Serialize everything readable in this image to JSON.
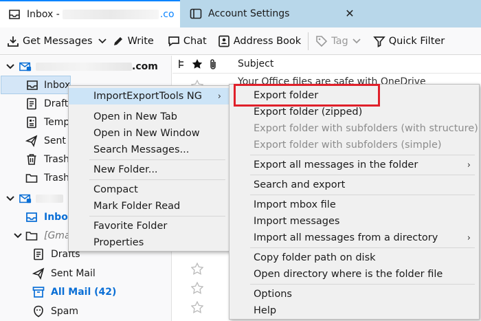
{
  "tabs": [
    {
      "label": "Inbox - ",
      "suffix": ".co"
    },
    {
      "label": "Account Settings"
    }
  ],
  "toolbar": {
    "get_messages": "Get Messages",
    "write": "Write",
    "chat": "Chat",
    "address_book": "Address Book",
    "tag": "Tag",
    "quick_filter": "Quick Filter"
  },
  "folders": {
    "account1_suffix": ".com",
    "inbox": "Inbox",
    "drafts": "Drafts",
    "templates": "Temp",
    "sent": "Sent",
    "trash1": "Trash",
    "trash2": "Trash",
    "account2_inbox": "Inbox",
    "gmail_group": "[Gma",
    "gmail_drafts": "Drafts",
    "gmail_sent": "Sent Mail",
    "gmail_allmail": "All Mail (42)",
    "gmail_spam": "Spam"
  },
  "thread": {
    "subject_header": "Subject",
    "first_subject": "Your Office files are safe with OneDrive"
  },
  "context_menu": {
    "import_export": "ImportExportTools NG",
    "open_new_tab": "Open in New Tab",
    "open_new_window": "Open in New Window",
    "search_messages": "Search Messages...",
    "new_folder": "New Folder...",
    "compact": "Compact",
    "mark_read": "Mark Folder Read",
    "favorite": "Favorite Folder",
    "properties": "Properties"
  },
  "submenu": {
    "export_folder": "Export folder",
    "export_zipped": "Export folder (zipped)",
    "export_sub_structure": "Export folder with subfolders (with structure)",
    "export_sub_simple": "Export folder with subfolders (simple)",
    "export_all": "Export all messages in the folder",
    "search_export": "Search and export",
    "import_mbox": "Import mbox file",
    "import_messages": "Import messages",
    "import_all_dir": "Import all messages from a directory",
    "copy_path": "Copy folder path on disk",
    "open_dir": "Open directory where is the folder file",
    "options": "Options",
    "help": "Help"
  },
  "colors": {
    "accent": "#0a84ff",
    "highlight_box": "#e0202a",
    "menu_highlight": "#cce4f7"
  }
}
